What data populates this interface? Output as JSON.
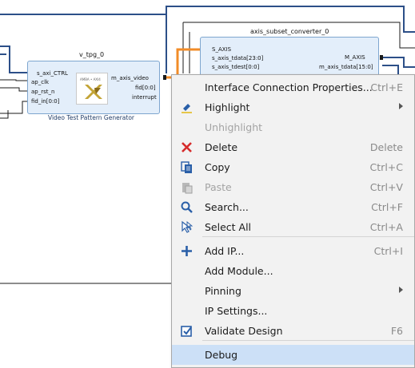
{
  "colors": {
    "net_bus": "#2c4f88",
    "net_wire": "#1a1a1a",
    "net_selected": "#f28c28",
    "block_fill": "#e3eefa",
    "menu_bg": "#f2f2f2",
    "menu_highlight": "#cce0f7",
    "delete_red": "#d62b2b",
    "icon_blue": "#2a5fa8"
  },
  "diagram": {
    "vtpg": {
      "instance_name": "v_tpg_0",
      "subtitle": "Video Test Pattern Generator",
      "ports_left": [
        "s_axi_CTRL",
        "ap_clk",
        "ap_rst_n",
        "fid_in[0:0]"
      ],
      "ports_right": [
        "m_axis_video",
        "fid[0:0]",
        "interrupt"
      ],
      "logo_text": "AMBA • AXI4"
    },
    "subset": {
      "instance_name": "axis_subset_converter_0",
      "ports_left": [
        "S_AXIS",
        "s_axis_tdata[23:0]",
        "s_axis_tdest[0:0]"
      ],
      "ports_right": [
        "M_AXIS",
        "m_axis_tdata[15:0]"
      ]
    }
  },
  "context_menu": {
    "items": [
      {
        "label": "Interface Connection Properties...",
        "shortcut": "Ctrl+E",
        "icon": "none",
        "enabled": true
      },
      {
        "label": "Highlight",
        "shortcut": "",
        "icon": "highlighter-icon",
        "enabled": true,
        "submenu": true
      },
      {
        "label": "Unhighlight",
        "shortcut": "",
        "icon": "none",
        "enabled": false
      },
      {
        "label": "Delete",
        "shortcut": "Delete",
        "icon": "delete-x-icon",
        "enabled": true
      },
      {
        "label": "Copy",
        "shortcut": "Ctrl+C",
        "icon": "copy-icon",
        "enabled": true
      },
      {
        "label": "Paste",
        "shortcut": "Ctrl+V",
        "icon": "paste-icon",
        "enabled": false
      },
      {
        "label": "Search...",
        "shortcut": "Ctrl+F",
        "icon": "search-icon",
        "enabled": true
      },
      {
        "label": "Select All",
        "shortcut": "Ctrl+A",
        "icon": "select-all-icon",
        "enabled": true
      },
      {
        "label": "Add IP...",
        "shortcut": "Ctrl+I",
        "icon": "plus-icon",
        "enabled": true
      },
      {
        "label": "Add Module...",
        "shortcut": "",
        "icon": "none",
        "enabled": true
      },
      {
        "label": "Pinning",
        "shortcut": "",
        "icon": "none",
        "enabled": true,
        "submenu": true
      },
      {
        "label": "IP Settings...",
        "shortcut": "",
        "icon": "none",
        "enabled": true
      },
      {
        "label": "Validate Design",
        "shortcut": "F6",
        "icon": "validate-checkbox-icon",
        "enabled": true
      },
      {
        "label": "Debug",
        "shortcut": "",
        "icon": "none",
        "enabled": true,
        "highlighted": true
      }
    ]
  }
}
